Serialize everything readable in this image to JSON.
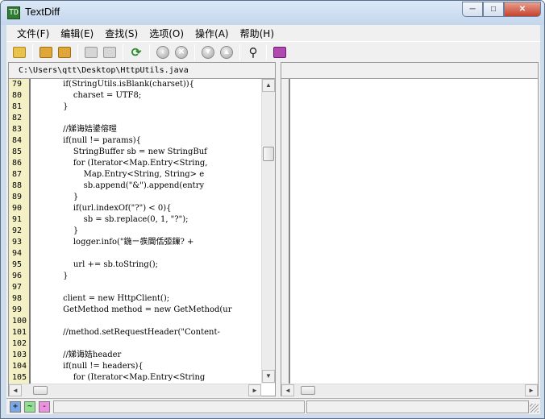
{
  "window": {
    "title": "TextDiff",
    "icon_char": "TD",
    "controls": {
      "minimize": "─",
      "maximize": "□",
      "close": "✕"
    }
  },
  "menu": [
    "文件(F)",
    "编辑(E)",
    "查找(S)",
    "选项(O)",
    "操作(A)",
    "帮助(H)"
  ],
  "toolbar": [
    {
      "name": "open-folder-icon",
      "glyph": "",
      "color": "#e8c24a"
    },
    {
      "name": "open-left-icon",
      "glyph": "",
      "color": "#e0a63a"
    },
    {
      "name": "open-right-icon",
      "glyph": "",
      "color": "#e0a63a"
    },
    {
      "name": "save-left-icon",
      "glyph": "",
      "color": "#c9c9c9"
    },
    {
      "name": "save-right-icon",
      "glyph": "",
      "color": "#c9c9c9"
    },
    {
      "name": "refresh-compare-icon",
      "glyph": "⟳",
      "color": "#2e8b2e"
    },
    {
      "name": "prev-diff-icon",
      "glyph": "‹"
    },
    {
      "name": "stop-icon",
      "glyph": "✕"
    },
    {
      "name": "next-diff-icon",
      "glyph": "▼"
    },
    {
      "name": "first-diff-icon",
      "glyph": "▲"
    },
    {
      "name": "find-icon",
      "glyph": "⚲",
      "color": "#333333"
    },
    {
      "name": "help-book-icon",
      "glyph": "",
      "color": "#b04ab0"
    }
  ],
  "left_pane": {
    "path": "C:\\Users\\qtt\\Desktop\\HttpUtils.java",
    "lines": [
      {
        "n": "79",
        "code": "            if(StringUtils.isBlank(charset)){"
      },
      {
        "n": "80",
        "code": "                charset = UTF8;"
      },
      {
        "n": "81",
        "code": "            }"
      },
      {
        "n": "82",
        "code": ""
      },
      {
        "n": "83",
        "code": "            //娣诲姞鍙傛暟"
      },
      {
        "n": "84",
        "code": "            if(null != params){"
      },
      {
        "n": "85",
        "code": "                StringBuffer sb = new StringBuf"
      },
      {
        "n": "86",
        "code": "                for (Iterator<Map.Entry<String,"
      },
      {
        "n": "87",
        "code": "                    Map.Entry<String, String> e"
      },
      {
        "n": "88",
        "code": "                    sb.append(\"&\").append(entry"
      },
      {
        "n": "89",
        "code": "                }"
      },
      {
        "n": "90",
        "code": "                if(url.indexOf(\"?\") < 0){"
      },
      {
        "n": "91",
        "code": "                    sb = sb.replace(0, 1, \"?\");"
      },
      {
        "n": "92",
        "code": "                }"
      },
      {
        "n": "93",
        "code": "                logger.info(\"鍦ㄧ彂閫佸弬鏁? +"
      },
      {
        "n": "94",
        "code": ""
      },
      {
        "n": "95",
        "code": "                url += sb.toString();"
      },
      {
        "n": "96",
        "code": "            }"
      },
      {
        "n": "97",
        "code": ""
      },
      {
        "n": "98",
        "code": "            client = new HttpClient();"
      },
      {
        "n": "99",
        "code": "            GetMethod method = new GetMethod(ur"
      },
      {
        "n": "100",
        "code": ""
      },
      {
        "n": "101",
        "code": "            //method.setRequestHeader(\"Content-"
      },
      {
        "n": "102",
        "code": ""
      },
      {
        "n": "103",
        "code": "            //娣诲姞header"
      },
      {
        "n": "104",
        "code": "            if(null != headers){"
      },
      {
        "n": "105",
        "code": "                for (Iterator<Map.Entry<String"
      }
    ]
  },
  "right_pane": {
    "path": ""
  },
  "status": {
    "add_marker": "+",
    "change_marker": "~",
    "delete_marker": "-",
    "add_color": "#7aa7e8",
    "change_color": "#8fe08f",
    "delete_color": "#ee8fe0"
  },
  "scroll": {
    "up": "▲",
    "down": "▼",
    "left": "◄",
    "right": "►"
  }
}
